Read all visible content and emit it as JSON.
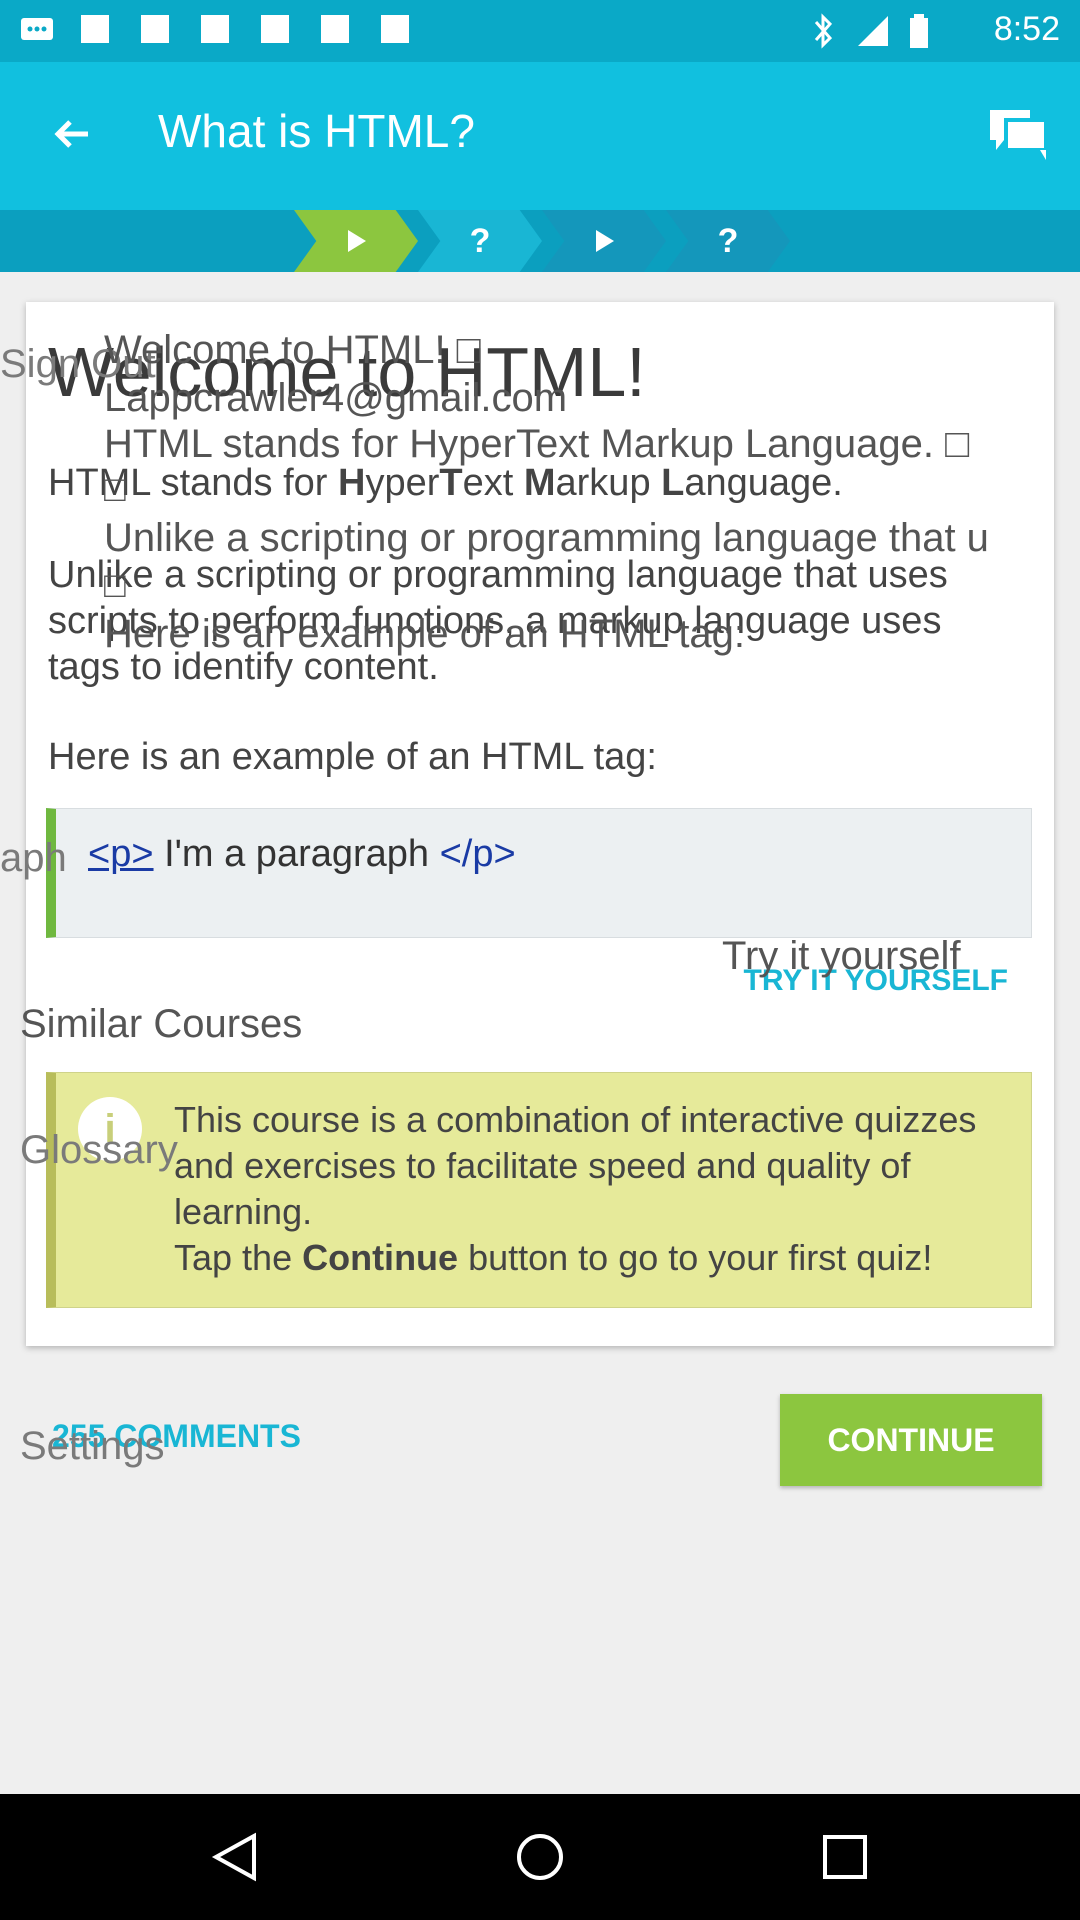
{
  "status_bar": {
    "time": "8:52",
    "icons": [
      "message-icon",
      "image-icon",
      "image-icon",
      "image-icon",
      "image-icon",
      "image-icon",
      "image-icon",
      "bluetooth-icon",
      "signal-icon",
      "battery-icon"
    ]
  },
  "app_bar": {
    "title": "What is HTML?",
    "back_icon": "arrow-left-icon",
    "chat_icon": "chat-icon"
  },
  "progress": {
    "steps": [
      {
        "icon": "play-icon",
        "color": "#8cc63f"
      },
      {
        "icon": "question-icon",
        "color": "#19b6d4"
      },
      {
        "icon": "play-icon",
        "color": "#1497bb"
      },
      {
        "icon": "question-icon",
        "color": "#1497bb"
      }
    ]
  },
  "lesson": {
    "heading": "Welcome to HTML!",
    "p1_parts": [
      "HTML stands for ",
      "H",
      "yper",
      "T",
      "ext ",
      "M",
      "arkup ",
      "L",
      "anguage."
    ],
    "p2": "Unlike a scripting or programming language that uses scripts to perform functions, a markup language uses tags to identify content.",
    "p3": "Here is an example of an HTML tag:",
    "code": {
      "open_tag": "<p>",
      "text": " I'm a paragraph ",
      "close_tag": "</p>"
    },
    "try_label": "TRY IT YOURSELF",
    "info_text_1": "This course is a combination of interactive quizzes and exercises to facilitate speed and quality of learning.",
    "info_text_2a": "Tap the ",
    "info_text_2b": "Continue",
    "info_text_2c": " button to go to your first quiz!"
  },
  "footer": {
    "comments_label": "255 COMMENTS",
    "continue_label": "CONTINUE"
  },
  "overlay_text": {
    "sign_out": "Sign Out",
    "welcome": "Welcome to HTML! □",
    "email": "Lappcrawler4@gmail.com",
    "stands": "HTML stands for HyperText Markup Language. □",
    "sym1": "□",
    "unlike": "Unlike a scripting or programming language that u",
    "sym2": "□",
    "here": "Here is an example of an HTML tag:",
    "aph": "aph",
    "try": "Try it yourself",
    "similar": "Similar Courses",
    "glossary": "Glossary",
    "settings": "Settings"
  }
}
